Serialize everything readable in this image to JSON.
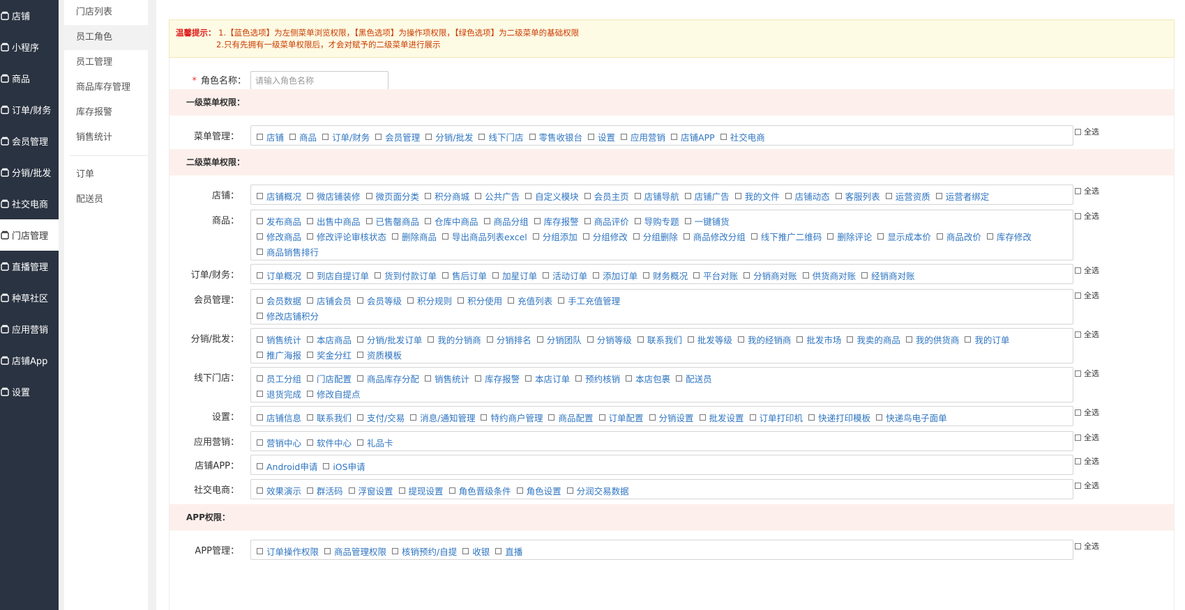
{
  "sidebar": {
    "items": [
      {
        "label": "店铺",
        "icon": "store-icon"
      },
      {
        "label": "小程序",
        "icon": "mini-program-icon"
      },
      {
        "label": "商品",
        "icon": "goods-icon"
      },
      {
        "label": "订单/财务",
        "icon": "order-finance-icon"
      },
      {
        "label": "会员管理",
        "icon": "member-icon"
      },
      {
        "label": "分销/批发",
        "icon": "distribution-icon"
      },
      {
        "label": "社交电商",
        "icon": "social-icon"
      },
      {
        "label": "门店管理",
        "icon": "home-icon",
        "active": true
      },
      {
        "label": "直播管理",
        "icon": "live-icon"
      },
      {
        "label": "种草社区",
        "icon": "community-icon"
      },
      {
        "label": "应用营销",
        "icon": "marketing-icon"
      },
      {
        "label": "店铺App",
        "icon": "app-icon"
      },
      {
        "label": "设置",
        "icon": "gear-icon"
      }
    ]
  },
  "subnav": {
    "group1": [
      "门店列表",
      "员工角色",
      "员工管理",
      "商品库存管理",
      "库存报警",
      "销售统计"
    ],
    "group2": [
      "订单",
      "配送员"
    ],
    "active": "员工角色"
  },
  "notice": {
    "title": "温馨提示：",
    "line1": "1.【蓝色选项】为左侧菜单浏览权限，【黑色选项】为操作项权限，【绿色选项】为二级菜单的基础权限",
    "line2": "2.只有先拥有一级菜单权限后，才会对赋予的二级菜单进行展示"
  },
  "role": {
    "required_mark": "*",
    "label": "角色名称：",
    "placeholder": "请输入角色名称"
  },
  "select_all_label": "全选",
  "sections": {
    "level1": "一级菜单权限：",
    "level2": "二级菜单权限：",
    "app": "APP权限："
  },
  "level1": {
    "label": "菜单管理：",
    "lines": [
      [
        "店铺",
        "商品",
        "订单/财务",
        "会员管理",
        "分销/批发",
        "线下门店",
        "零售收银台",
        "设置",
        "应用营销",
        "店铺APP",
        "社交电商"
      ]
    ]
  },
  "level2": [
    {
      "label": "店铺：",
      "lines": [
        [
          "店铺概况",
          "微店铺装修",
          "微页面分类",
          "积分商城",
          "公共广告",
          "自定义模块",
          "会员主页",
          "店铺导航",
          "店铺广告",
          "我的文件",
          "店铺动态",
          "客服列表",
          "运营资质",
          "运营者绑定"
        ]
      ]
    },
    {
      "label": "商品：",
      "lines": [
        [
          "发布商品",
          "出售中商品",
          "已售罄商品",
          "仓库中商品",
          "商品分组",
          "库存报警",
          "商品评价",
          "导购专题",
          "一键铺货"
        ],
        [
          "修改商品",
          "修改评论审核状态",
          "删除商品",
          "导出商品列表excel",
          "分组添加",
          "分组修改",
          "分组删除",
          "商品修改分组",
          "线下推广二维码",
          "删除评论",
          "显示成本价",
          "商品改价",
          "库存修改"
        ],
        [
          "商品销售排行"
        ]
      ]
    },
    {
      "label": "订单/财务：",
      "lines": [
        [
          "订单概况",
          "到店自提订单",
          "货到付款订单",
          "售后订单",
          "加星订单",
          "活动订单",
          "添加订单",
          "财务概况",
          "平台对账",
          "分销商对账",
          "供货商对账",
          "经销商对账"
        ]
      ]
    },
    {
      "label": "会员管理：",
      "lines": [
        [
          "会员数据",
          "店铺会员",
          "会员等级",
          "积分规则",
          "积分使用",
          "充值列表",
          "手工充值管理"
        ],
        [
          "修改店铺积分"
        ]
      ]
    },
    {
      "label": "分销/批发：",
      "lines": [
        [
          "销售统计",
          "本店商品",
          "分销/批发订单",
          "我的分销商",
          "分销排名",
          "分销团队",
          "分销等级",
          "联系我们",
          "批发等级",
          "我的经销商",
          "批发市场",
          "我卖的商品",
          "我的供货商",
          "我的订单"
        ],
        [
          "推广海报",
          "奖金分红",
          "资质模板"
        ]
      ]
    },
    {
      "label": "线下门店：",
      "lines": [
        [
          "员工分组",
          "门店配置",
          "商品库存分配",
          "销售统计",
          "库存报警",
          "本店订单",
          "预约核销",
          "本店包裹",
          "配送员"
        ],
        [
          "退货完成",
          "修改自提点"
        ]
      ]
    },
    {
      "label": "设置：",
      "lines": [
        [
          "店铺信息",
          "联系我们",
          "支付/交易",
          "消息/通知管理",
          "特约商户管理",
          "商品配置",
          "订单配置",
          "分销设置",
          "批发设置",
          "订单打印机",
          "快递打印模板",
          "快递鸟电子面单"
        ]
      ]
    },
    {
      "label": "应用营销：",
      "lines": [
        [
          "营销中心",
          "软件中心",
          "礼品卡"
        ]
      ]
    },
    {
      "label": "店铺APP：",
      "lines": [
        [
          "Android申请",
          "iOS申请"
        ]
      ]
    },
    {
      "label": "社交电商：",
      "lines": [
        [
          "效果演示",
          "群活码",
          "浮窗设置",
          "提现设置",
          "角色晋级条件",
          "角色设置",
          "分润交易数据"
        ]
      ]
    }
  ],
  "app": {
    "label": "APP管理：",
    "lines": [
      [
        "订单操作权限",
        "商品管理权限",
        "核销预约/自提",
        "收银",
        "直播"
      ]
    ]
  }
}
